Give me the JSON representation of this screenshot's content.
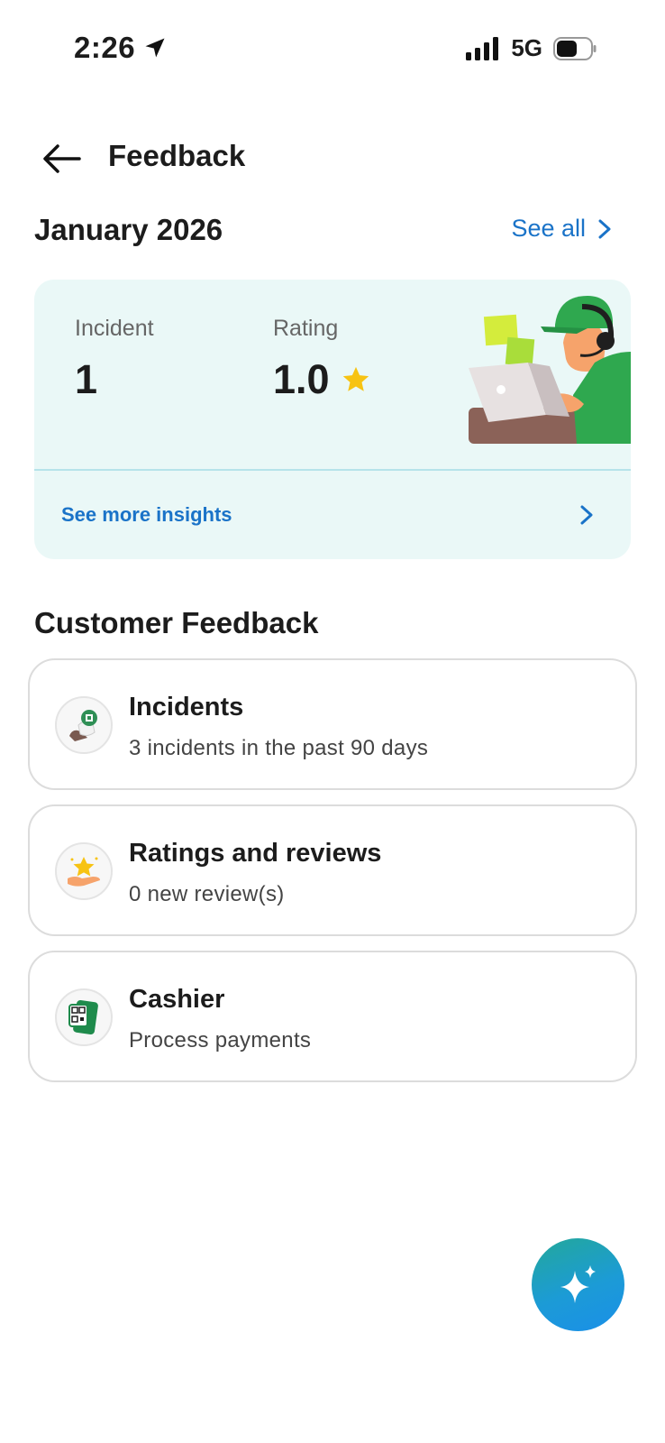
{
  "status_bar": {
    "time": "2:26",
    "network": "5G"
  },
  "header": {
    "title": "Feedback",
    "back_icon": "arrow-left-icon"
  },
  "month_section": {
    "month": "January 2026",
    "see_all_label": "See all"
  },
  "summary": {
    "incident_label": "Incident",
    "incident_value": "1",
    "rating_label": "Rating",
    "rating_value": "1.0",
    "insights_label": "See more insights"
  },
  "customer_feedback": {
    "title": "Customer Feedback",
    "items": [
      {
        "title": "Incidents",
        "subtitle": "3 incidents in the past 90 days",
        "icon": "incident-icon"
      },
      {
        "title": "Ratings and reviews",
        "subtitle": "0 new review(s)",
        "icon": "star-hand-icon"
      },
      {
        "title": "Cashier",
        "subtitle": "Process payments",
        "icon": "qr-phone-icon"
      }
    ]
  },
  "colors": {
    "accent": "#1a73c8",
    "card_bg": "#eaf8f7",
    "star": "#f7c313"
  }
}
